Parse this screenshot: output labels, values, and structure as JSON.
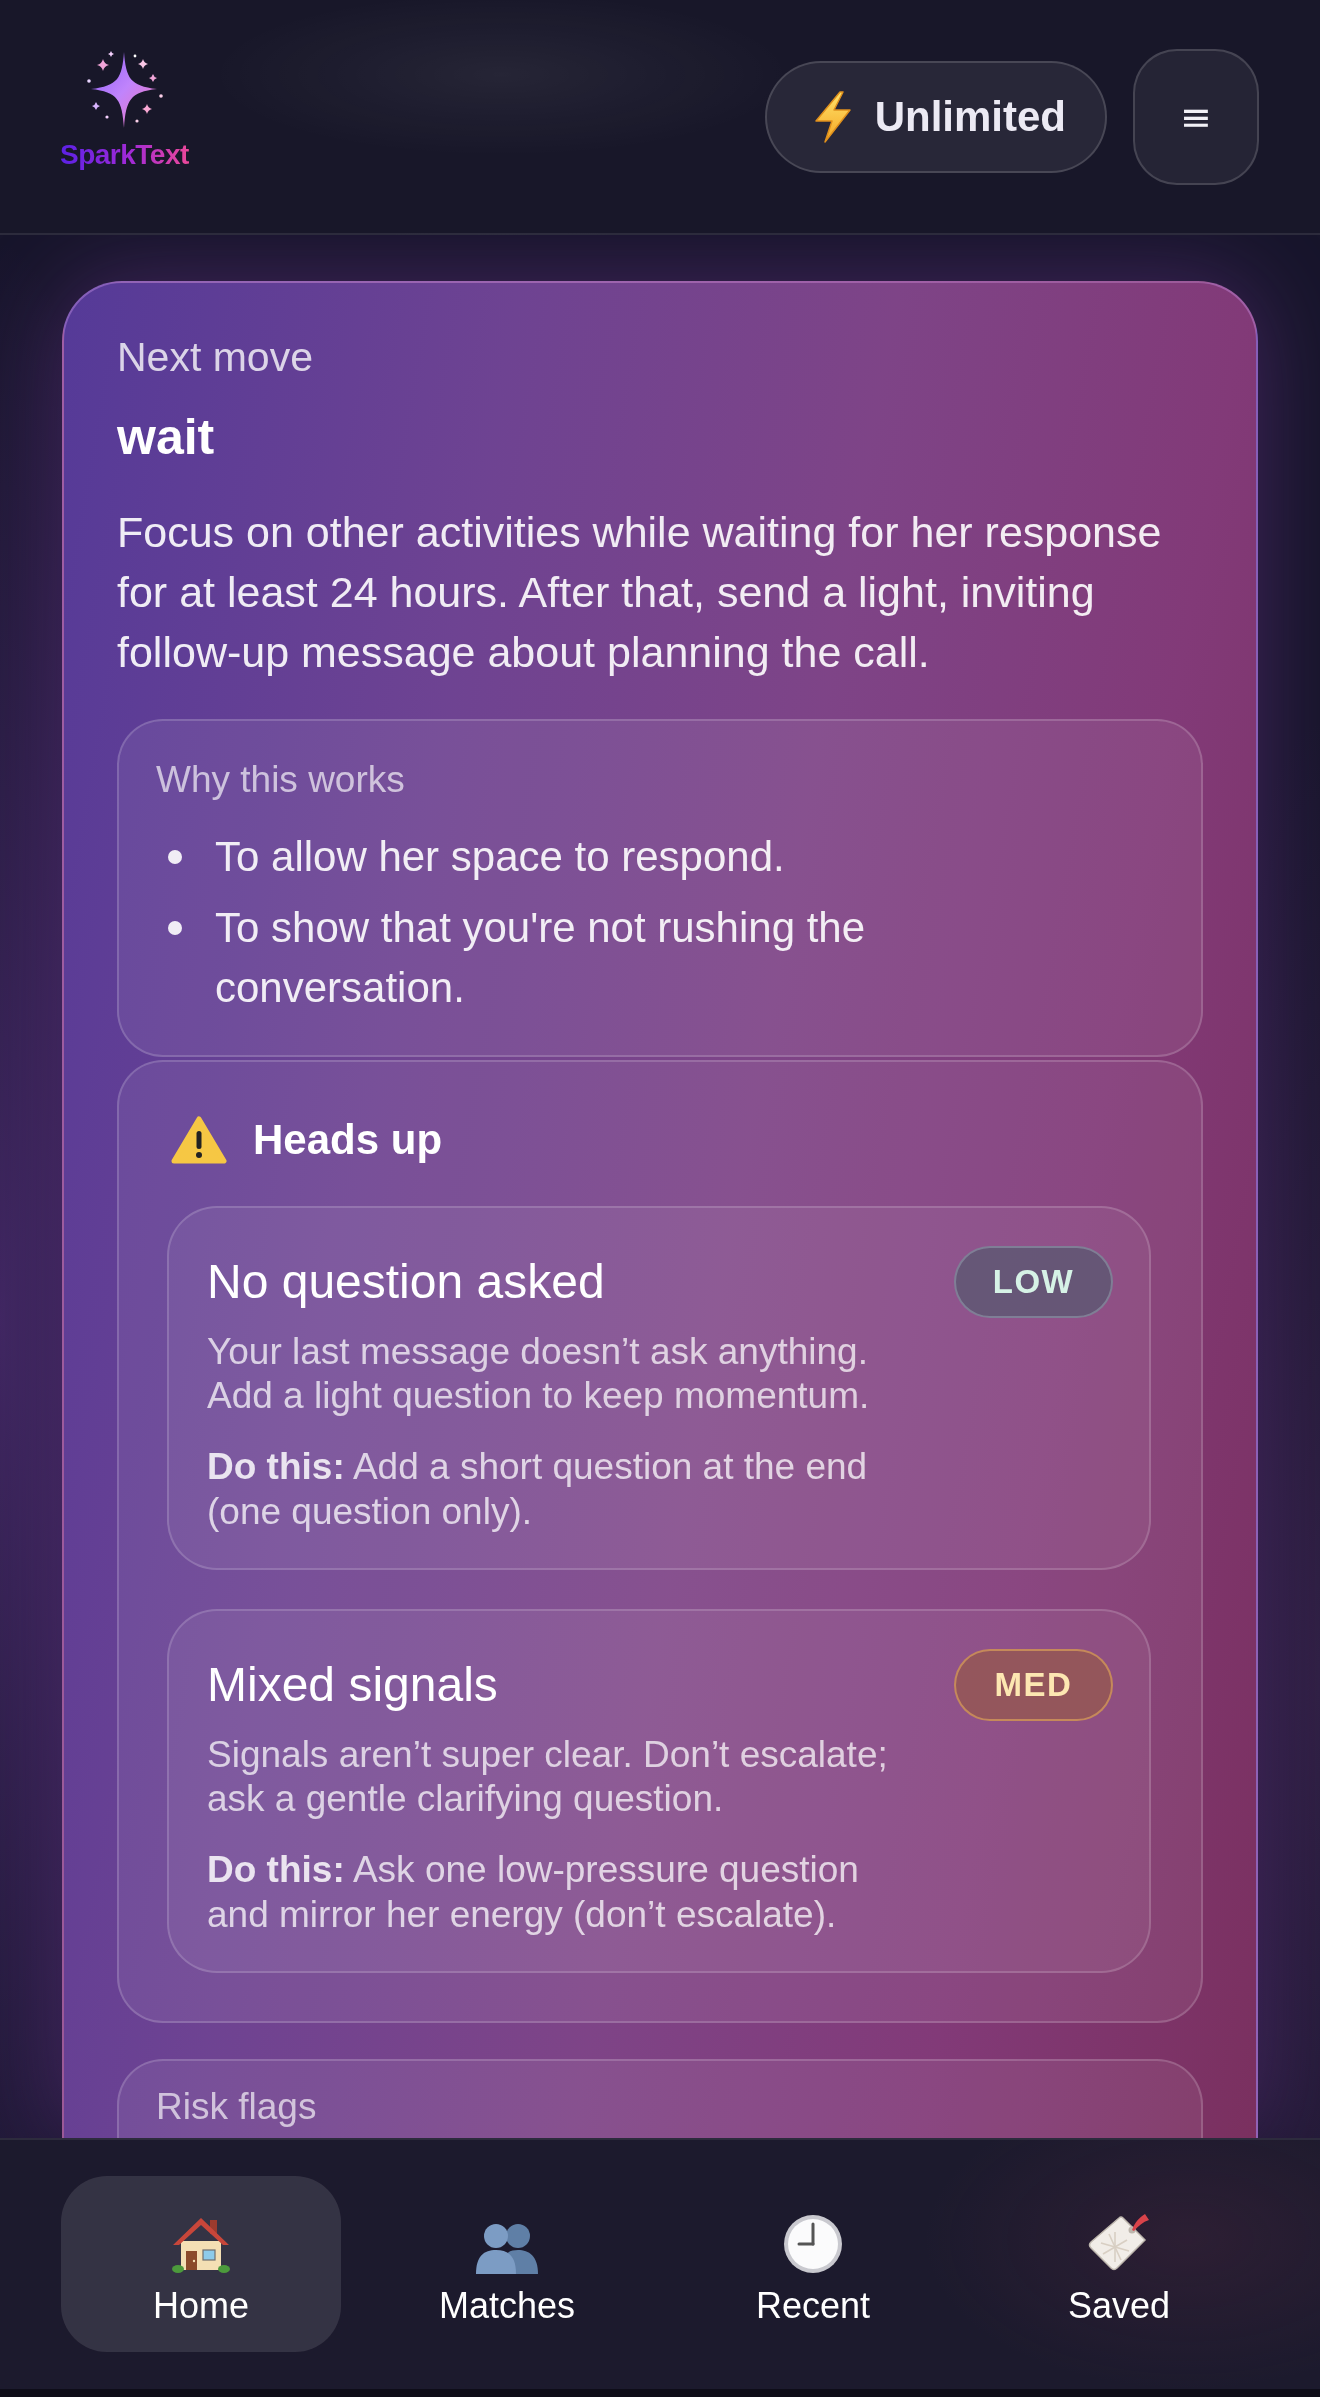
{
  "header": {
    "logo_text": "SparkText",
    "plan_button": "Unlimited",
    "menu_button": "≡"
  },
  "next_move": {
    "label": "Next move",
    "action": "wait",
    "description": "Focus on other activities while waiting for her response for at least 24 hours. After that, send a light, inviting follow-up message about planning the call.",
    "why": {
      "title": "Why this works",
      "points": [
        "To allow her space to respond.",
        "To show that you're not rushing the conversation."
      ]
    },
    "heads_up": {
      "title": "Heads up",
      "issues": [
        {
          "title": "No question asked",
          "badge": "LOW",
          "kind": "low",
          "description": "Your last message doesn’t ask anything. Add a light question to keep momentum.",
          "action": "**Do this:** Add a short question at the end (one question only)."
        },
        {
          "title": "Mixed signals",
          "badge": "MED",
          "kind": "medium",
          "description": "Signals aren’t super clear. Don’t escalate; ask a gentle clarifying question.",
          "action": "**Do this:** Ask one low-pressure question and mirror her energy (don’t escalate)."
        }
      ]
    },
    "risk_flags": {
      "title": "Risk flags"
    }
  },
  "nav": {
    "tabs": [
      {
        "label": "Home",
        "selected": true
      },
      {
        "label": "Matches",
        "selected": false
      },
      {
        "label": "Recent",
        "selected": false
      },
      {
        "label": "Saved",
        "selected": false
      }
    ]
  }
}
